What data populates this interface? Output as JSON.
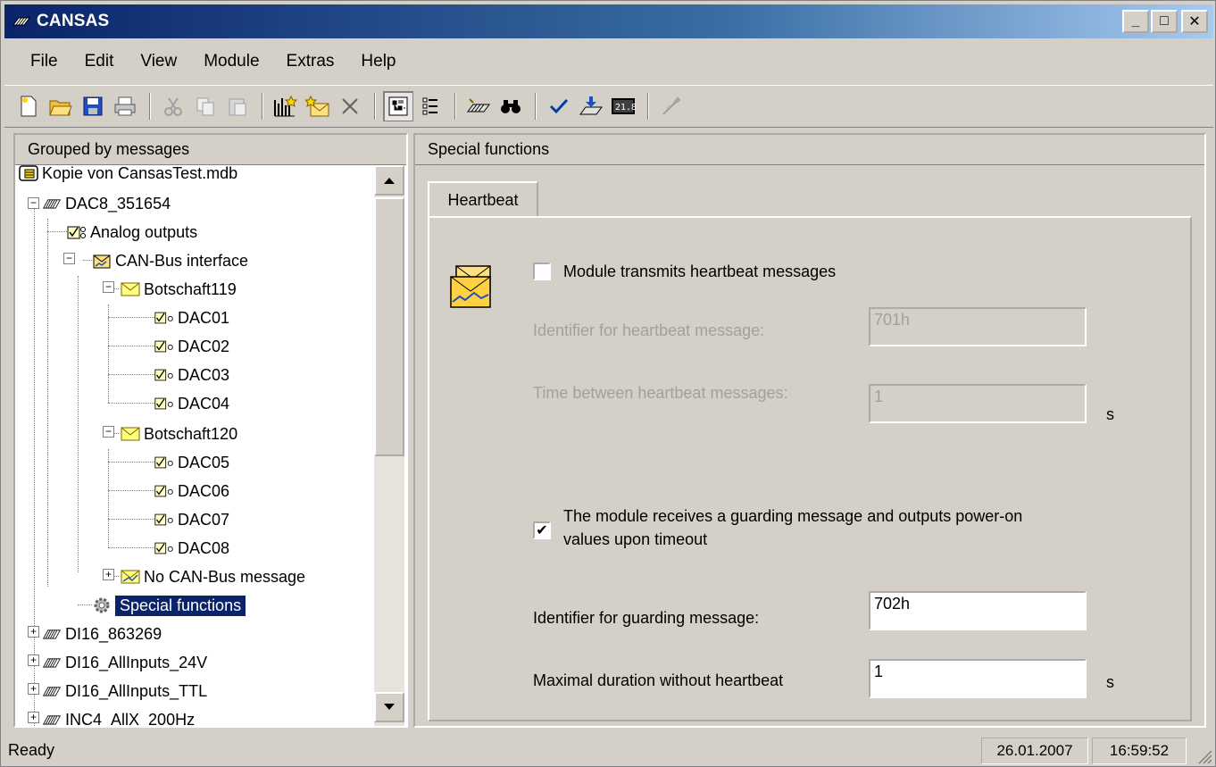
{
  "window": {
    "title": "CANSAS",
    "minimize": "_",
    "maximize": "□",
    "close": "✕"
  },
  "menu": [
    {
      "label": "File",
      "key": "F"
    },
    {
      "label": "Edit",
      "key": "E"
    },
    {
      "label": "View",
      "key": "V"
    },
    {
      "label": "Module",
      "key": "M"
    },
    {
      "label": "Extras",
      "key": "E"
    },
    {
      "label": "Help",
      "key": "H"
    }
  ],
  "left": {
    "header": "Grouped by messages"
  },
  "tree": [
    {
      "label": "Kopie von CansasTest.mdb",
      "icon": "database-icon"
    },
    {
      "label": "DAC8_351654",
      "icon": "module-icon"
    },
    {
      "label": "Analog outputs",
      "icon": "analog-outputs-icon"
    },
    {
      "label": "CAN-Bus interface",
      "icon": "can-bus-icon"
    },
    {
      "label": "Botschaft119",
      "icon": "message-icon"
    },
    {
      "label": "DAC01",
      "icon": "channel-icon"
    },
    {
      "label": "DAC02",
      "icon": "channel-icon"
    },
    {
      "label": "DAC03",
      "icon": "channel-icon"
    },
    {
      "label": "DAC04",
      "icon": "channel-icon"
    },
    {
      "label": "Botschaft120",
      "icon": "message-icon"
    },
    {
      "label": "DAC05",
      "icon": "channel-icon"
    },
    {
      "label": "DAC06",
      "icon": "channel-icon"
    },
    {
      "label": "DAC07",
      "icon": "channel-icon"
    },
    {
      "label": "DAC08",
      "icon": "channel-icon"
    },
    {
      "label": "No CAN-Bus message",
      "icon": "no-message-icon"
    },
    {
      "label": "Special functions",
      "icon": "gear-icon"
    },
    {
      "label": "DI16_863269",
      "icon": "module-icon"
    },
    {
      "label": "DI16_AllInputs_24V",
      "icon": "module-icon"
    },
    {
      "label": "DI16_AllInputs_TTL",
      "icon": "module-icon"
    },
    {
      "label": "INC4_AllX_200Hz",
      "icon": "module-icon"
    }
  ],
  "right": {
    "header": "Special functions",
    "tab": "Heartbeat",
    "transmit_label": "Module transmits heartbeat messages",
    "transmit_checked": false,
    "hb_id_label": "Identifier for heartbeat message:",
    "hb_id_value": "701h",
    "hb_time_label": "Time between heartbeat messages:",
    "hb_time_value": "1",
    "hb_time_unit": "s",
    "guard_label_1": "The module receives a guarding message and outputs power-on",
    "guard_label_2": "values upon timeout",
    "guard_checked": true,
    "guard_check_mark": "✔",
    "guard_id_label": "Identifier for guarding message:",
    "guard_id_value": "702h",
    "max_dur_label": "Maximal duration without heartbeat",
    "max_dur_value": "1",
    "max_dur_unit": "s"
  },
  "status": {
    "text": "Ready",
    "date": "26.01.2007",
    "time": "16:59:52"
  }
}
